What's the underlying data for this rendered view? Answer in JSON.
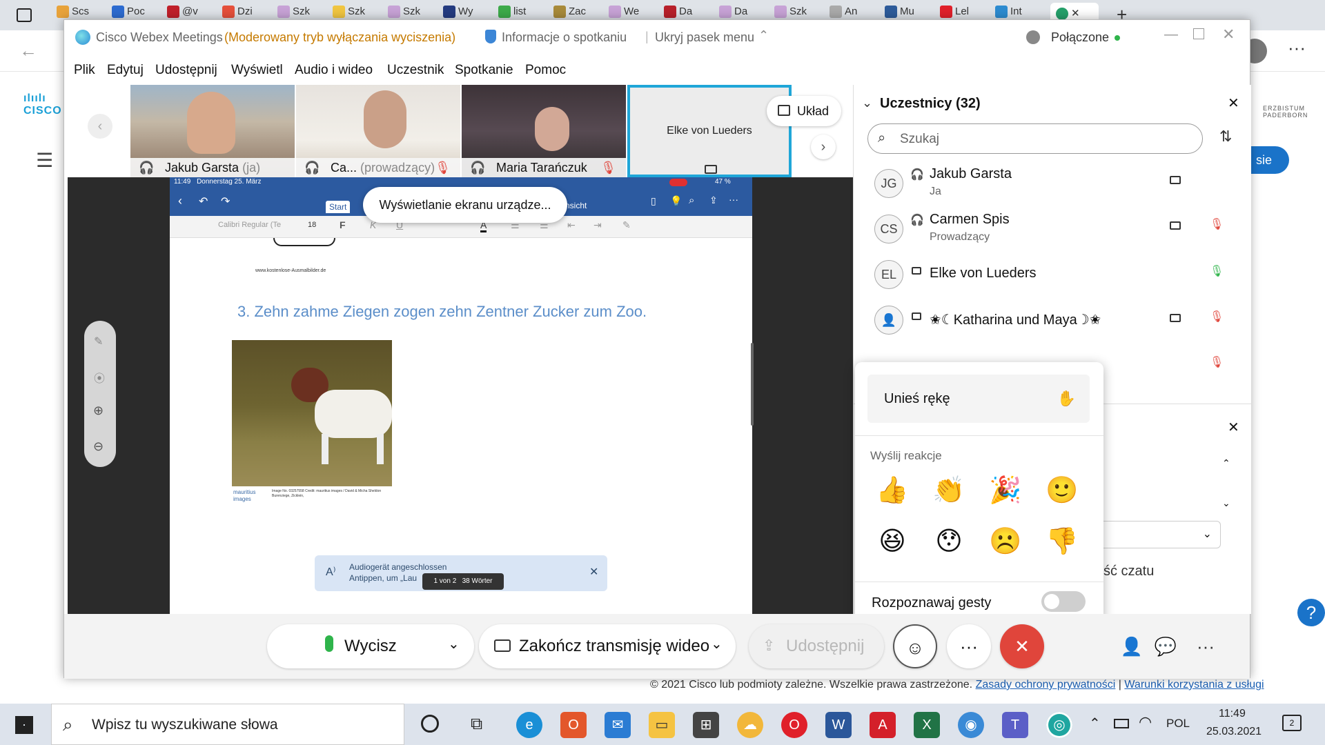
{
  "browser": {
    "tabs": [
      "Scs",
      "Poc",
      "@v",
      "Dzi",
      "Szk",
      "Szk",
      "Szk",
      "Wy",
      "list",
      "Zac",
      "We",
      "Da",
      "Da",
      "Szk",
      "An",
      "Mu",
      "Lel",
      "Int"
    ],
    "right_logo": "ERZBISTUM PADERBORN",
    "login_button": "sie"
  },
  "window": {
    "app_name": "Cisco Webex Meetings",
    "mode": "(Moderowany tryb wyłączania wyciszenia)",
    "meeting_info": "Informacje o spotkaniu",
    "hide_menu": "Ukryj pasek menu",
    "connection": "Połączone"
  },
  "menu": [
    "Plik",
    "Edytuj",
    "Udostępnij",
    "Wyświetl",
    "Audio i wideo",
    "Uczestnik",
    "Spotkanie",
    "Pomoc"
  ],
  "thumbnails": [
    {
      "name": "Jakub Garsta",
      "suffix": "(ja)"
    },
    {
      "name": "Ca...",
      "suffix": "(prowadzący)"
    },
    {
      "name": "Maria Tarańczuk",
      "suffix": ""
    },
    {
      "name": "Elke von Lueders",
      "suffix": ""
    }
  ],
  "layout_button": "Układ",
  "share_toast": "Wyświetlanie ekranu urządze...",
  "ipad": {
    "time": "11:49",
    "date": "Donnerstag 25. März",
    "battery": "47 %",
    "tab_start": "Start",
    "tab_view": "Ansicht",
    "font_name": "Calibri Regular (Te",
    "font_size": "18",
    "fmt_bold": "F",
    "fmt_italic": "K",
    "fmt_underline": "U",
    "site": "www.kostenlose-Ausmalbilder.de",
    "sentence": "3. Zehn zahme Ziegen zogen zehn Zentner Zucker zum Zoo.",
    "credit_logo": "mauritius images",
    "credit_text": "Image No. 03257558 Credit: mauritius images / David & Micha Sheldon Burenziege, Zicklein,",
    "toast_title": "Audiogerät angeschlossen",
    "toast_body": "Antippen, um „Lau",
    "page_info": "1 von 2   38 Wörter"
  },
  "participants": {
    "title": "Uczestnicy (32)",
    "search_placeholder": "Szukaj",
    "list": [
      {
        "initials": "JG",
        "name": "Jakub Garsta",
        "role": "Ja"
      },
      {
        "initials": "CS",
        "name": "Carmen Spis",
        "role": "Prowadzący"
      },
      {
        "initials": "EL",
        "name": "Elke von Lueders",
        "role": ""
      },
      {
        "initials": "",
        "name": "✬☾Katharina und Maya☽✬",
        "role": ""
      }
    ]
  },
  "chat": {
    "partial_label": "ść czatu"
  },
  "reactions": {
    "raise_hand": "Unieś rękę",
    "send_label": "Wyślij reakcje",
    "emojis": [
      "👍",
      "👏",
      "🎉",
      "🙂",
      "😆",
      "😯",
      "☹️",
      "👎"
    ],
    "gestures": "Rozpoznawaj gesty"
  },
  "controls": {
    "mute": "Wycisz",
    "video": "Zakończ transmisję wideo",
    "share": "Udostępnij",
    "more": "···"
  },
  "footer": {
    "copyright": "© 2021 Cisco lub podmioty zależne. Wszelkie prawa zastrzeżone.",
    "privacy": "Zasady ochrony prywatności",
    "sep": "|",
    "terms": "Warunki korzystania z usługi"
  },
  "taskbar": {
    "search": "Wpisz tu wyszukiwane słowa",
    "lang": "POL",
    "time": "11:49",
    "date": "25.03.2021",
    "notif": "2"
  },
  "colors": {
    "accent": "#1fa6d8",
    "end": "#e0453b",
    "blue": "#2d7bd0"
  }
}
